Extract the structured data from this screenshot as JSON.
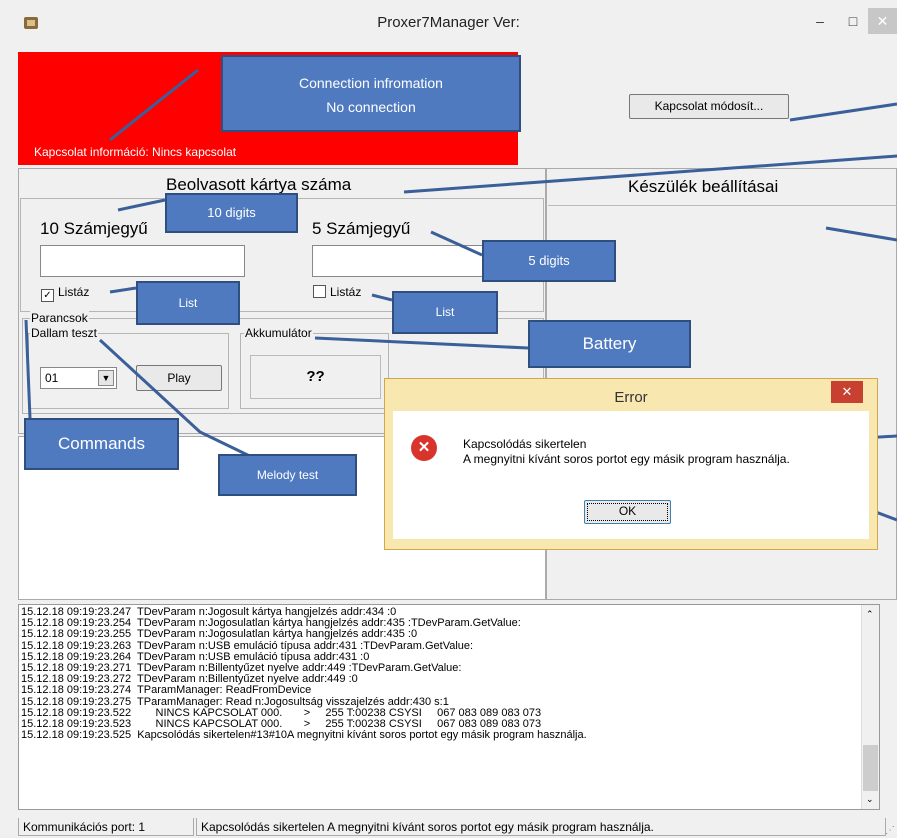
{
  "window": {
    "title": "Proxer7Manager Ver:"
  },
  "connection": {
    "label": "Kapcsolat információ: Nincs kapcsolat",
    "modify_button": "Kapcsolat módosít..."
  },
  "card_panel": {
    "title": "Beolvasott kártya száma",
    "ten_digit_label": "10 Számjegyű",
    "five_digit_label": "5 Számjegyű",
    "ten_digit_value": "",
    "five_digit_value": "",
    "list_checkbox_1": "Listáz",
    "list_checkbox_2": "Listáz",
    "list_checkbox_1_checked": true,
    "list_checkbox_2_checked": false
  },
  "commands": {
    "group_label": "Parancsok",
    "melody_label": "Dallam teszt",
    "melody_select": "01",
    "play_button": "Play",
    "battery_label": "Akkumulátor",
    "battery_value": "??"
  },
  "device_settings": {
    "title": "Készülék beállításai"
  },
  "annotations": {
    "connection_info": [
      "Connection infromation",
      "No connection"
    ],
    "ten_digits": "10 digits",
    "five_digits": "5 digits",
    "list_1": "List",
    "list_2": "List",
    "battery": "Battery",
    "commands": "Commands",
    "melody": "Melody test"
  },
  "error_dialog": {
    "title": "Error",
    "message_line1": "Kapcsolódás sikertelen",
    "message_line2": "A megnyitni kívánt soros portot egy másik program használja.",
    "ok_button": "OK"
  },
  "log": [
    "15.12.18 09:19:23.247  TDevParam n:Jogosult kártya hangjelzés addr:434 :0",
    "15.12.18 09:19:23.254  TDevParam n:Jogosulatlan kártya hangjelzés addr:435 :TDevParam.GetValue:",
    "15.12.18 09:19:23.255  TDevParam n:Jogosulatlan kártya hangjelzés addr:435 :0",
    "15.12.18 09:19:23.263  TDevParam n:USB emuláció típusa addr:431 :TDevParam.GetValue:",
    "15.12.18 09:19:23.264  TDevParam n:USB emuláció típusa addr:431 :0",
    "15.12.18 09:19:23.271  TDevParam n:Billentyűzet nyelve addr:449 :TDevParam.GetValue:",
    "15.12.18 09:19:23.272  TDevParam n:Billentyűzet nyelve addr:449 :0",
    "15.12.18 09:19:23.274  TParamManager: ReadFromDevice",
    "15.12.18 09:19:23.275  TParamManager: Read n:Jogosultság visszajelzés addr:430 s:1",
    "15.12.18 09:19:23.522        NINCS KAPCSOLAT 000.       >     255 T:00238 CSYSI     067 083 089 083 073",
    "15.12.18 09:19:23.523        NINCS KAPCSOLAT 000.       >     255 T:00238 CSYSI     067 083 089 083 073",
    "15.12.18 09:19:23.525  Kapcsolódás sikertelen#13#10A megnyitni kívánt soros portot egy másik program használja."
  ],
  "status_bar": {
    "port": "Kommunikációs port: 1",
    "message": "Kapcsolódás sikertelen  A megnyitni kívánt soros portot egy másik program használja."
  },
  "colors": {
    "red_panel": "#ff0000",
    "callout": "#4f7ac0",
    "dialog_frame": "#f8e8b0",
    "close_red": "#c84030"
  }
}
